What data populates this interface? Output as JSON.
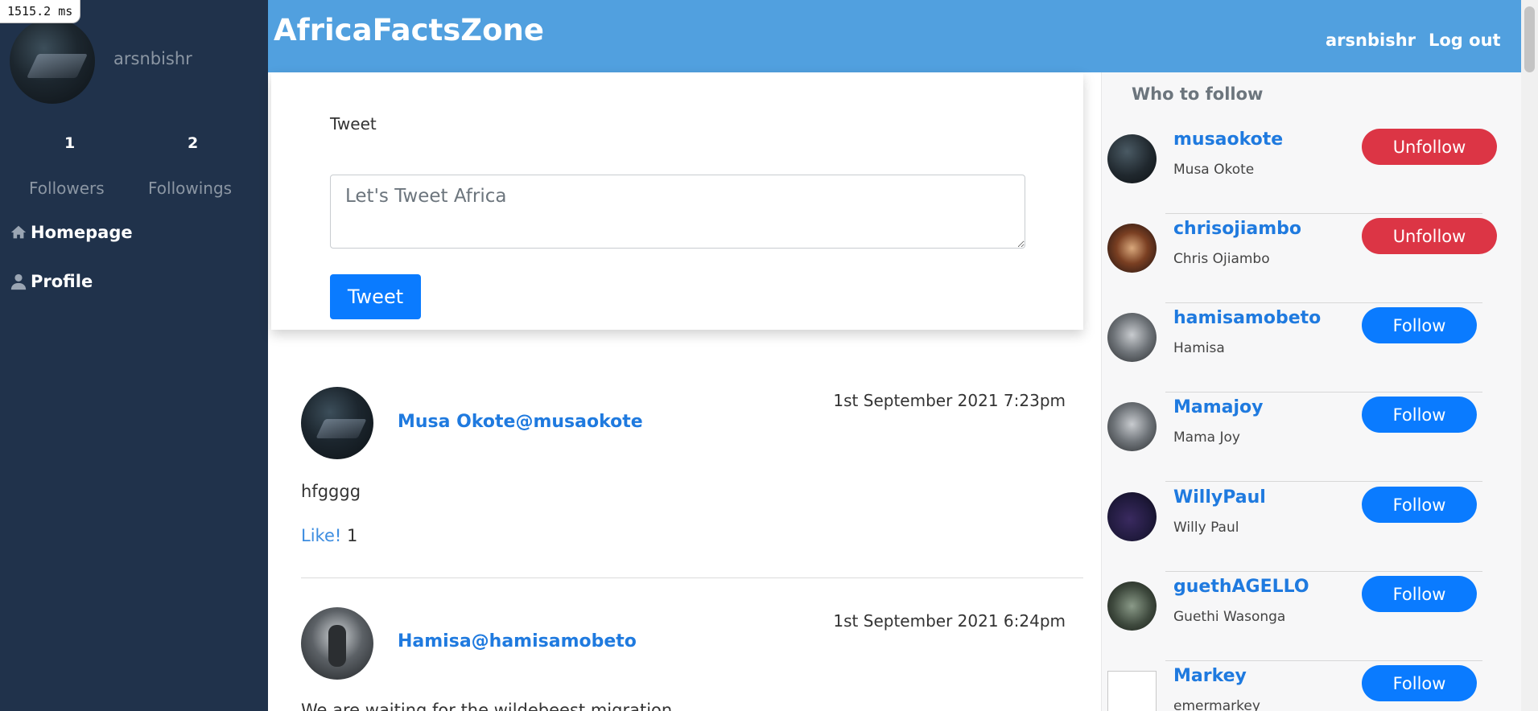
{
  "timing": "1515.2 ms",
  "sidebar": {
    "username": "arsnbishr",
    "followers_count": "1",
    "followers_label": "Followers",
    "followings_count": "2",
    "followings_label": "Followings",
    "nav": [
      {
        "label": "Homepage",
        "icon": "home-icon"
      },
      {
        "label": "Profile",
        "icon": "user-icon"
      }
    ]
  },
  "header": {
    "brand": "AfricaFactsZone",
    "user_link": "arsnbishr",
    "logout": "Log out"
  },
  "composer": {
    "heading": "Tweet",
    "placeholder": "Let's Tweet Africa",
    "button": "Tweet"
  },
  "posts": [
    {
      "author": "Musa Okote@musaokote",
      "date": "1st September 2021 7:23pm",
      "body": "hfgggg",
      "like_label": "Like!",
      "likes": "1"
    },
    {
      "author": "Hamisa@hamisamobeto",
      "date": "1st September 2021 6:24pm",
      "body": "We are waiting for the wildebeest migration"
    }
  ],
  "who_to_follow": {
    "title": "Who to follow",
    "users": [
      {
        "handle": "musaokote",
        "name": "Musa Okote",
        "action": "Unfollow"
      },
      {
        "handle": "chrisojiambo",
        "name": "Chris Ojiambo",
        "action": "Unfollow"
      },
      {
        "handle": "hamisamobeto",
        "name": "Hamisa",
        "action": "Follow"
      },
      {
        "handle": "Mamajoy",
        "name": "Mama Joy",
        "action": "Follow"
      },
      {
        "handle": "WillyPaul",
        "name": "Willy Paul",
        "action": "Follow"
      },
      {
        "handle": "guethAGELLO",
        "name": "Guethi Wasonga",
        "action": "Follow"
      },
      {
        "handle": "Markey",
        "name": "emermarkey",
        "action": "Follow"
      }
    ]
  },
  "colors": {
    "sidebar_bg": "#20324b",
    "topbar_bg": "#51a0df",
    "primary": "#0a7bff",
    "danger": "#dc3545",
    "link": "#1f7adf"
  }
}
